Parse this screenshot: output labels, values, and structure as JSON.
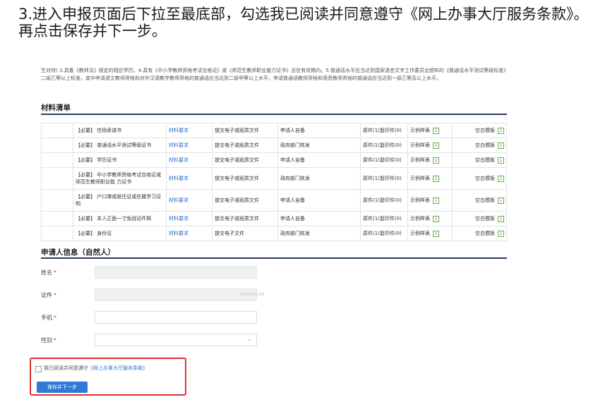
{
  "heading": "3.进入申报页面后下拉至最底部，勾选我已阅读并同意遵守《网上办事大厅服务条款》。再点击保存并下一步。",
  "intro_text": "生对待) 3.具备《教师法》规定的相应学历。4.具有《中小学教师资格考试合格证》或《师范生教师职业能力证书》且在有效期内。5.普通话水平应当达到国家语言文字工作委员会颁布的《普通话水平测试等级标准》二级乙等以上标准，其中申请语文教师资格和对外汉语教学教师资格的普通话应当达到二级甲等以上水平，申请普通话教师资格和语音教师资格的普通话应当达到一级乙等及以上水平。",
  "materials": {
    "title": "材料清单",
    "rows": [
      {
        "name": "【必要】 信用承诺书",
        "req": "材料要求",
        "submit": "提交电子或纸质文件",
        "source": "申请人自备",
        "count": "原件(1)复印件(0)",
        "sample": "示例样表",
        "template": "空白模板"
      },
      {
        "name": "【必要】 普通话水平测试等级证书",
        "req": "材料要求",
        "submit": "提交电子或纸质文件",
        "source": "政府部门核发",
        "count": "原件(1)复印件(0)",
        "sample": "示例样表",
        "template": "空白模板"
      },
      {
        "name": "【必要】 学历证书",
        "req": "材料要求",
        "submit": "提交电子或纸质文件",
        "source": "申请人自备",
        "count": "原件(1)复印件(0)",
        "sample": "示例样表",
        "template": "空白模板"
      },
      {
        "name": "【必要】 中小学教师资格考试合格证或师范生教师职业能 力证书",
        "req": "材料要求",
        "submit": "提交电子或纸质文件",
        "source": "政府部门核发",
        "count": "原件(1)复印件(0)",
        "sample": "示例样表",
        "template": "空白模板"
      },
      {
        "name": "【必要】 户口簿或居住证或在籍学习证明",
        "req": "材料要求",
        "submit": "提交电子或纸质文件",
        "source": "申请人自备",
        "count": "原件(1)复印件(0)",
        "sample": "示例样表",
        "template": "空白模板"
      },
      {
        "name": "【必要】 本人正面一寸免冠证件照",
        "req": "材料要求",
        "submit": "提交电子或纸质文件",
        "source": "申请人自备",
        "count": "原件(1)复印件(0)",
        "sample": "示例样表",
        "template": "空白模板"
      },
      {
        "name": "【必要】 身份证",
        "req": "材料要求",
        "submit": "提交电子文件",
        "source": "政府部门核发",
        "count": "原件(1)复印件(0)",
        "sample": "示例样表",
        "template": "空白模板"
      }
    ]
  },
  "applicant": {
    "title": "申请人信息（自然人）",
    "name_label": "姓名",
    "id_label": "证件",
    "id_value": "000000188",
    "phone_label": "手机",
    "gender_label": "性别",
    "required_mark": "*"
  },
  "agreement": {
    "prefix": "我已阅读并同意遵守",
    "link": "《网上办事大厅服务条款》",
    "button": "保存并下一步"
  },
  "colors": {
    "accent": "#2e7ad8",
    "highlight": "#e0302c",
    "link": "#2e6fd1"
  }
}
